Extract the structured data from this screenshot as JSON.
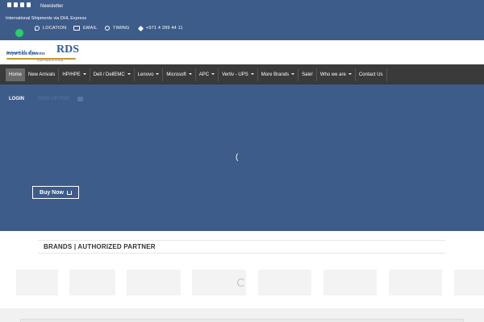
{
  "topbar": {
    "social_icons": [
      "facebook-icon",
      "instagram-icon",
      "twitter-icon",
      "linkedin-icon"
    ],
    "newsletter": "Newsletter",
    "shipping": "International Shipments via DHL Express",
    "location": "LOCATION",
    "email": "EMAIL",
    "timing": "TIMING",
    "phone": "+971 4 289 44 11"
  },
  "logo": {
    "name_line1": "Royal Data Systems",
    "name_line2": "رويال داتا سيستمز",
    "mark": "RDS",
    "tagline": "Smart Solutions Consult"
  },
  "nav": {
    "items": [
      {
        "label": "Home",
        "dropdown": false
      },
      {
        "label": "New Arrivals",
        "dropdown": false
      },
      {
        "label": "HP/HPE",
        "dropdown": true
      },
      {
        "label": "Dell / DellEMC",
        "dropdown": true
      },
      {
        "label": "Lenovo",
        "dropdown": true
      },
      {
        "label": "Microsoft",
        "dropdown": true
      },
      {
        "label": "APC",
        "dropdown": true
      },
      {
        "label": "Vertiv - UPS",
        "dropdown": true
      },
      {
        "label": "More Brands",
        "dropdown": true
      },
      {
        "label": "Sale!",
        "dropdown": false
      },
      {
        "label": "Who we are",
        "dropdown": true
      },
      {
        "label": "Contact Us",
        "dropdown": false
      }
    ]
  },
  "hero": {
    "login": "LOGIN",
    "faint_text": "SIGN UP FOR",
    "spinner": "(",
    "buy_now": "Buy Now"
  },
  "brands": {
    "title": "BRANDS | AUTHORIZED PARTNER"
  },
  "colors": {
    "topbar": "#3e5c8a",
    "nav": "#3a3a3a",
    "nav_active": "#6a6a6a",
    "whatsapp": "#25d366"
  }
}
